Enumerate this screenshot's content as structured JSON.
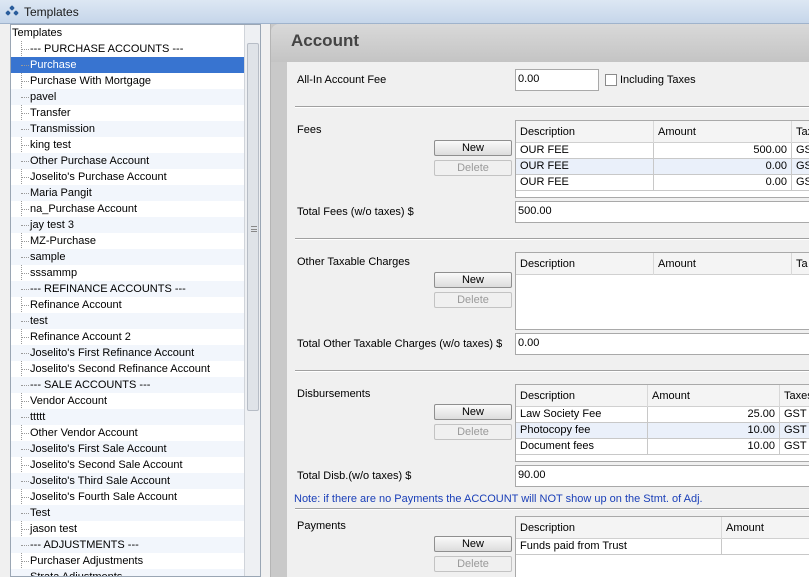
{
  "window": {
    "title": "Templates",
    "icon": "templates-icon"
  },
  "tree": {
    "root_label": "Templates",
    "items": [
      "--- PURCHASE ACCOUNTS ---",
      "Purchase",
      "Purchase With Mortgage",
      "pavel",
      "Transfer",
      "Transmission",
      "king test",
      "Other Purchase Account",
      "Joselito's Purchase Account",
      "Maria Pangit",
      "na_Purchase Account",
      "jay test 3",
      "MZ-Purchase",
      "sample",
      "sssammp",
      "--- REFINANCE ACCOUNTS ---",
      "Refinance Account",
      "test",
      "Refinance Account 2",
      "Joselito's First Refinance Account",
      "Joselito's Second Refinance Account",
      "--- SALE ACCOUNTS ---",
      "Vendor Account",
      "ttttt",
      "Other Vendor Account",
      "Joselito's First Sale Account",
      "Joselito's Second Sale Account",
      "Joselito's Third Sale Account",
      "Joselito's Fourth Sale Account",
      "Test",
      "jason test",
      "--- ADJUSTMENTS ---",
      "Purchaser Adjustments",
      "Strata Adjustments"
    ],
    "selected": "Purchase"
  },
  "account": {
    "heading": "Account",
    "all_in_fee_label": "All-In Account Fee",
    "all_in_fee_value": "0.00",
    "including_taxes_label": "Including Taxes",
    "new_label": "New",
    "delete_label": "Delete",
    "fees": {
      "label": "Fees",
      "columns": [
        "Description",
        "Amount",
        "Tax"
      ],
      "rows": [
        {
          "desc": "OUR FEE",
          "amount": "500.00",
          "tax": "GS"
        },
        {
          "desc": "OUR FEE",
          "amount": "0.00",
          "tax": "GS"
        },
        {
          "desc": "OUR FEE",
          "amount": "0.00",
          "tax": "GS"
        }
      ],
      "total_label": "Total Fees (w/o taxes) $",
      "total_value": "500.00"
    },
    "other_taxable": {
      "label": "Other Taxable Charges",
      "columns": [
        "Description",
        "Amount",
        "Ta"
      ],
      "total_label": "Total Other Taxable Charges (w/o taxes) $",
      "total_value": "0.00"
    },
    "disbursements": {
      "label": "Disbursements",
      "columns": [
        "Description",
        "Amount",
        "Taxes"
      ],
      "rows": [
        {
          "desc": "Law Society Fee",
          "amount": "25.00",
          "tax": "GST"
        },
        {
          "desc": "Photocopy fee",
          "amount": "10.00",
          "tax": "GST"
        },
        {
          "desc": "Document fees",
          "amount": "10.00",
          "tax": "GST"
        }
      ],
      "total_label": "Total Disb.(w/o taxes) $",
      "total_value": "90.00"
    },
    "note": "Note: if there are no Payments the ACCOUNT will NOT show up on the Stmt. of Adj.",
    "payments": {
      "label": "Payments",
      "columns": [
        "Description",
        "Amount"
      ],
      "rows": [
        {
          "desc": "Funds paid from Trust",
          "amount": ""
        }
      ]
    }
  }
}
